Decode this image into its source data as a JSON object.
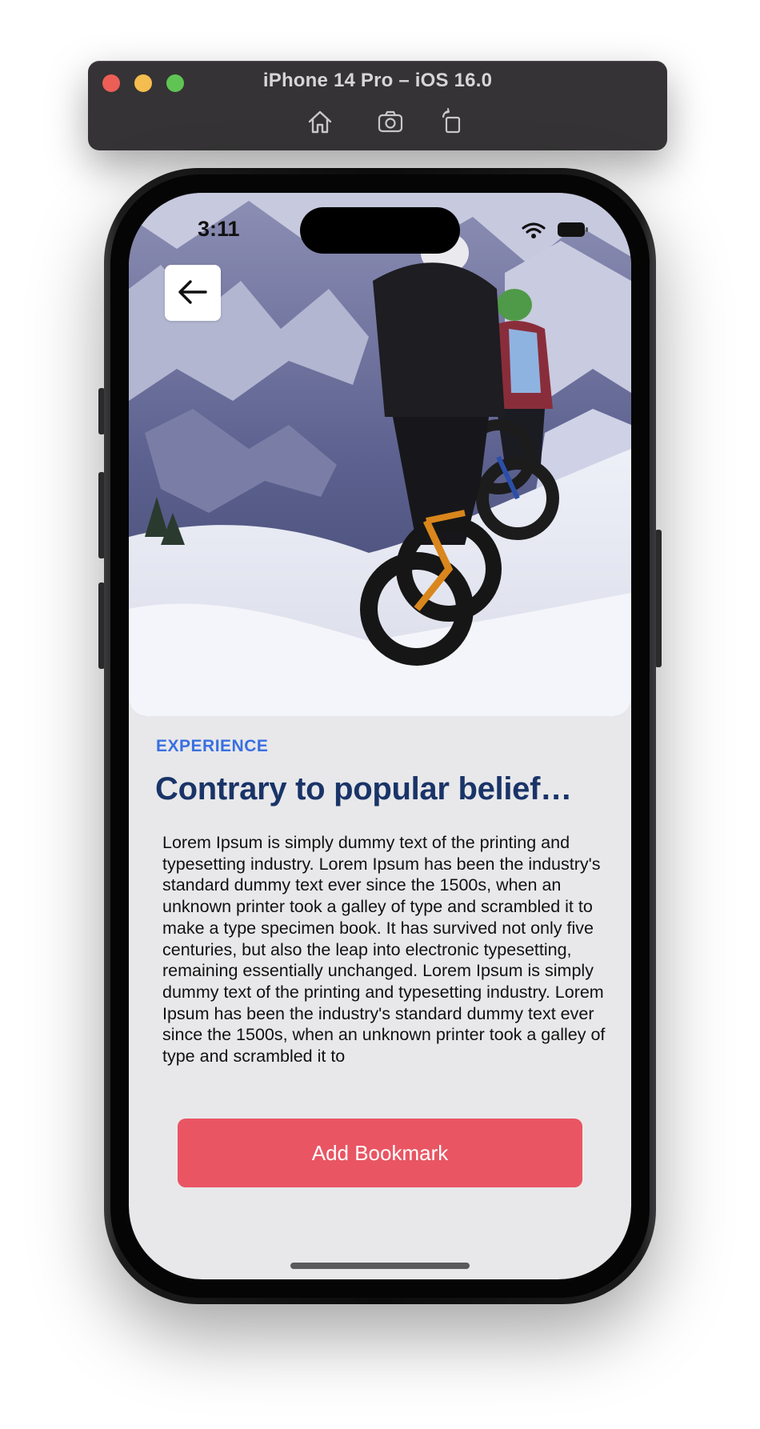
{
  "simulator": {
    "title": "iPhone 14 Pro – iOS 16.0",
    "toolbar_icons": [
      "home-icon",
      "screenshot-icon",
      "rotate-icon"
    ]
  },
  "status_bar": {
    "time": "3:11",
    "icons": [
      "wifi-icon",
      "battery-icon"
    ]
  },
  "hero": {
    "image": "snow-bikers-photo"
  },
  "nav": {
    "back_icon": "arrow-left-icon"
  },
  "article": {
    "category": "EXPERIENCE",
    "title": "Contrary to popular belief…",
    "body": "Lorem Ipsum is simply dummy text of the printing and typesetting industry. Lorem Ipsum has been the industry's standard dummy text ever since the 1500s, when an unknown printer took a galley of type and scrambled it to make a type specimen book. It has survived not only five centuries, but also the leap into electronic typesetting, remaining essentially unchanged. Lorem Ipsum is simply dummy text of the printing and typesetting industry. Lorem Ipsum has been the industry's standard dummy text ever since the 1500s, when an unknown printer took a galley of type and scrambled it to"
  },
  "actions": {
    "bookmark_label": "Add Bookmark"
  },
  "colors": {
    "accent_blue": "#3a6fe0",
    "title_navy": "#1a3468",
    "button_red": "#e95563",
    "screen_bg": "#e8e8ea"
  }
}
